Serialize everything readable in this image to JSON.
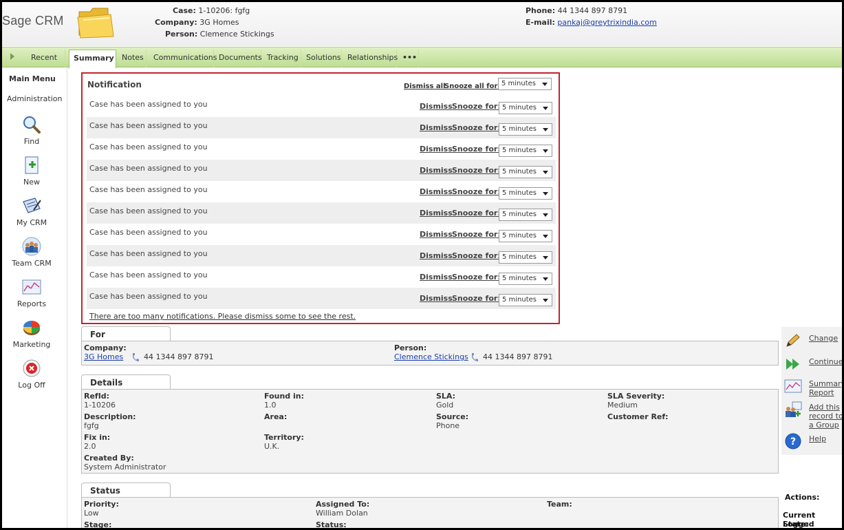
{
  "app": {
    "title": "Sage CRM"
  },
  "header": {
    "case_label": "Case:",
    "case_value": "1-10206: fgfg",
    "company_label": "Company:",
    "company_value": "3G Homes",
    "person_label": "Person:",
    "person_value": "Clemence Stickings",
    "phone_label": "Phone:",
    "phone_value": "44 1344 897 8791",
    "email_label": "E-mail:",
    "email_value": "pankaj@greytrixindia.com"
  },
  "tabs": [
    "Recent",
    "Summary",
    "Notes",
    "Communications",
    "Documents",
    "Tracking",
    "Solutions",
    "Relationships",
    "•••"
  ],
  "menu": {
    "title": "Main Menu",
    "admin": "Administration",
    "items": [
      "Find",
      "New",
      "My CRM",
      "Team CRM",
      "Reports",
      "Marketing",
      "Log Off"
    ]
  },
  "notification": {
    "title": "Notification",
    "dismiss_all": "Dismiss all",
    "snooze_all": "Snooze all for:",
    "snooze_all_value": "5 minutes",
    "rows": [
      {
        "message": "Case has been assigned to you",
        "dismiss": "Dismiss",
        "snooze": "Snooze for:",
        "value": "5 minutes"
      },
      {
        "message": "Case has been assigned to you",
        "dismiss": "Dismiss",
        "snooze": "Snooze for:",
        "value": "5 minutes"
      },
      {
        "message": "Case has been assigned to you",
        "dismiss": "Dismiss",
        "snooze": "Snooze for:",
        "value": "5 minutes"
      },
      {
        "message": "Case has been assigned to you",
        "dismiss": "Dismiss",
        "snooze": "Snooze for:",
        "value": "5 minutes"
      },
      {
        "message": "Case has been assigned to you",
        "dismiss": "Dismiss",
        "snooze": "Snooze for:",
        "value": "5 minutes"
      },
      {
        "message": "Case has been assigned to you",
        "dismiss": "Dismiss",
        "snooze": "Snooze for:",
        "value": "5 minutes"
      },
      {
        "message": "Case has been assigned to you",
        "dismiss": "Dismiss",
        "snooze": "Snooze for:",
        "value": "5 minutes"
      },
      {
        "message": "Case has been assigned to you",
        "dismiss": "Dismiss",
        "snooze": "Snooze for:",
        "value": "5 minutes"
      },
      {
        "message": "Case has been assigned to you",
        "dismiss": "Dismiss",
        "snooze": "Snooze for:",
        "value": "5 minutes"
      },
      {
        "message": "Case has been assigned to you",
        "dismiss": "Dismiss",
        "snooze": "Snooze for:",
        "value": "5 minutes"
      }
    ],
    "too_many": "There are too many notifications. Please dismiss some to see the rest."
  },
  "for_panel": {
    "title": "For",
    "company_label": "Company:",
    "company_value": "3G Homes",
    "company_phone": "44 1344 897 8791",
    "person_label": "Person:",
    "person_value": "Clemence Stickings",
    "person_phone": "44 1344 897 8791"
  },
  "details": {
    "title": "Details",
    "refid_label": "RefId:",
    "refid_value": "1-10206",
    "found_label": "Found in:",
    "found_value": "1.0",
    "sla_label": "SLA:",
    "sla_value": "Gold",
    "sev_label": "SLA Severity:",
    "sev_value": "Medium",
    "desc_label": "Description:",
    "desc_value": "fgfg",
    "area_label": "Area:",
    "source_label": "Source:",
    "source_value": "Phone",
    "custref_label": "Customer Ref:",
    "fixin_label": "Fix in:",
    "fixin_value": "2.0",
    "territory_label": "Territory:",
    "territory_value": "U.K.",
    "created_label": "Created By:",
    "created_value": "System Administrator"
  },
  "status": {
    "title": "Status",
    "priority_label": "Priority:",
    "priority_value": "Low",
    "assigned_label": "Assigned To:",
    "assigned_value": "William Dolan",
    "team_label": "Team:",
    "stage_label": "Stage:",
    "status_label": "Status:"
  },
  "actions": {
    "change": "Change",
    "continue": "Continue",
    "summary_report": "Summary Report",
    "add_group": "Add this record to a Group",
    "help": "Help",
    "actions_label": "Actions:",
    "current_state_label": "Current State:",
    "current_state_value": "Logged"
  }
}
